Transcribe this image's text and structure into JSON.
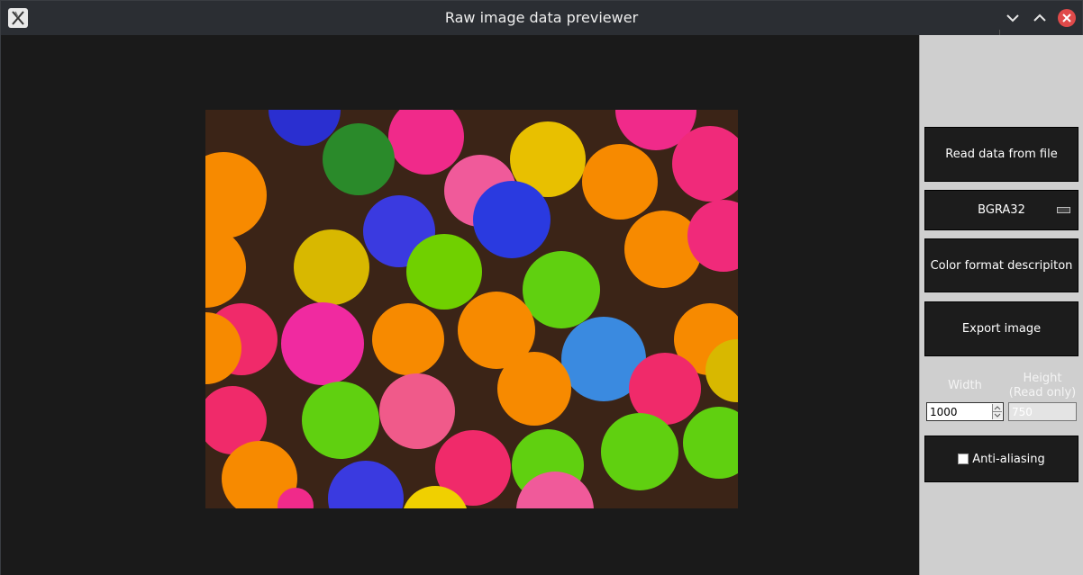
{
  "window": {
    "title": "Raw image data previewer"
  },
  "sidebar": {
    "read_button": "Read data from file",
    "format_select": "BGRA32",
    "desc_button": "Color format descripiton",
    "export_button": "Export image",
    "width_label": "Width",
    "height_label": "Height\n(Read only)",
    "width_value": "1000",
    "height_value": "750",
    "antialias_label": "Anti-aliasing",
    "antialias_checked": false
  },
  "icons": [
    "app-icon",
    "minimize-icon",
    "maximize-icon",
    "close-icon",
    "checkbox-icon"
  ],
  "colors": {
    "titlebar": "#2b2e33",
    "canvas": "#1a1a1a",
    "sidebar": "#cfcfcf",
    "close": "#e04a4a"
  }
}
